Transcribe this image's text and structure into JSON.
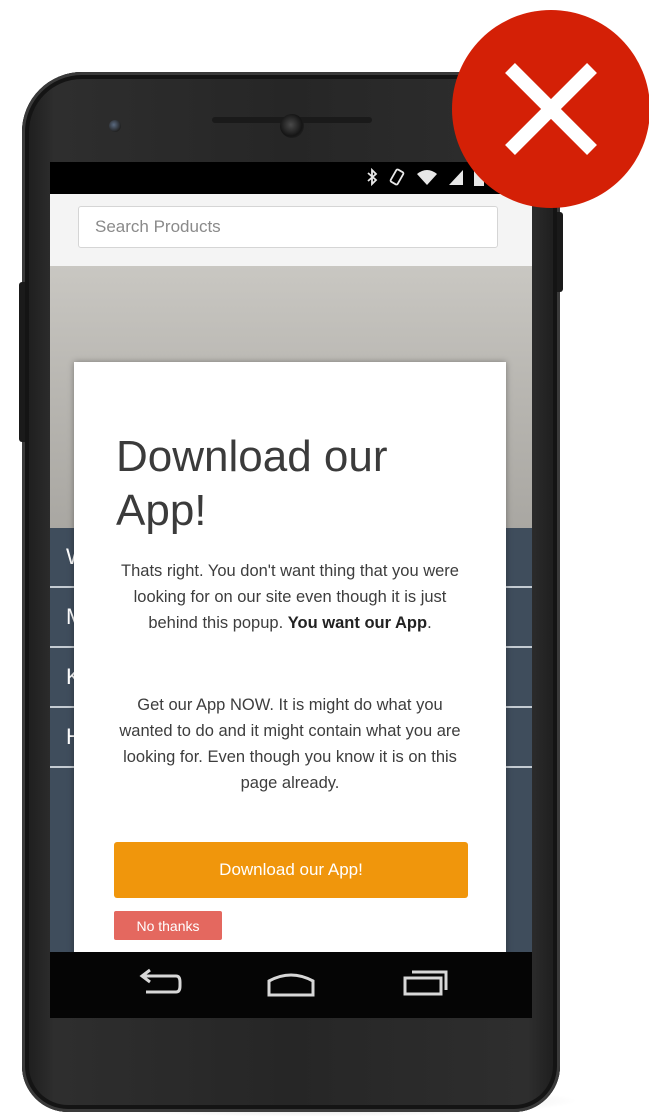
{
  "status_bar": {
    "icons": [
      "bluetooth-icon",
      "rotation-lock-icon",
      "wifi-icon",
      "signal-icon",
      "battery-icon"
    ]
  },
  "search": {
    "placeholder": "Search Products"
  },
  "nav": {
    "items": [
      "W",
      "M",
      "K",
      "H"
    ]
  },
  "popup": {
    "title": "Download our App!",
    "paragraph1_plain": "Thats right. You don't want thing that you were looking for on our site even though it is just behind this popup. ",
    "paragraph1_bold": "You want our App",
    "paragraph1_end": ".",
    "paragraph2": "Get our App NOW. It is might do what you wanted to do and it might contain what you are looking for. Even though you know it is on this page already.",
    "download_label": "Download our App!",
    "no_thanks_label": "No thanks"
  },
  "system_nav": {
    "icons": [
      "back-icon",
      "home-icon",
      "recents-icon"
    ]
  },
  "badge": {
    "icon": "close-x-icon",
    "color": "#d42006"
  },
  "colors": {
    "download_button": "#f0960c",
    "no_thanks_button": "#e4685f",
    "nav_background": "#3f4d5c"
  }
}
